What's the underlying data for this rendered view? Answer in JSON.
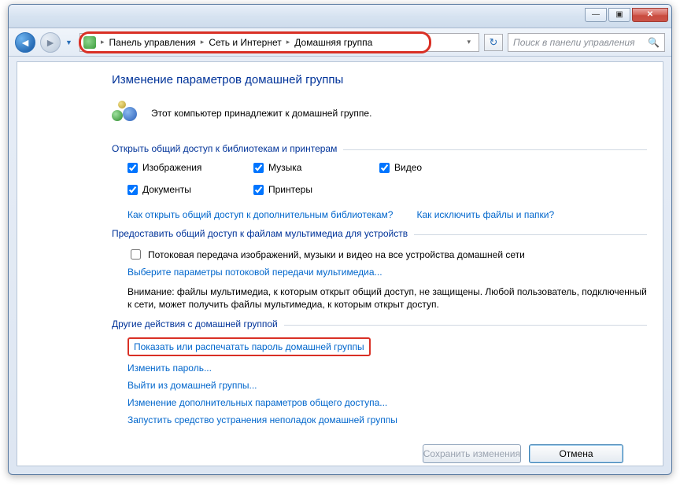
{
  "titlebar": {
    "min": "—",
    "max": "▣",
    "close": "✕"
  },
  "nav": {
    "back_glyph": "◄",
    "fwd_glyph": "►",
    "drop_glyph": "▼",
    "refresh_glyph": "↻",
    "search_glyph": "🔍",
    "search_placeholder": "Поиск в панели управления"
  },
  "breadcrumb": {
    "sep": "▸",
    "items": [
      "Панель управления",
      "Сеть и Интернет",
      "Домашняя группа"
    ],
    "tail": "▾"
  },
  "page": {
    "title": "Изменение параметров домашней группы",
    "belongs": "Этот компьютер принадлежит к домашней группе."
  },
  "share_section": {
    "header": "Открыть общий доступ к библиотекам и принтерам",
    "checks": {
      "images": "Изображения",
      "documents": "Документы",
      "music": "Музыка",
      "printers": "Принтеры",
      "video": "Видео"
    },
    "link_additional": "Как открыть общий доступ к дополнительным библиотекам?",
    "link_exclude": "Как исключить файлы и папки?"
  },
  "media_section": {
    "header": "Предоставить общий доступ к файлам мультимедиа для устройств",
    "stream_check": "Потоковая передача изображений, музыки и видео на все устройства домашней сети",
    "stream_link": "Выберите параметры потоковой передачи мультимедиа...",
    "warning": "Внимание: файлы мультимедиа, к которым открыт общий доступ, не защищены. Любой пользователь, подключенный к сети, может получить файлы мультимедиа, к которым открыт доступ."
  },
  "actions_section": {
    "header": "Другие действия с домашней группой",
    "show_password": "Показать или распечатать пароль домашней группы",
    "change_password": "Изменить пароль...",
    "leave_group": "Выйти из домашней группы...",
    "change_advanced": "Изменение дополнительных параметров общего доступа...",
    "troubleshoot": "Запустить средство устранения неполадок домашней группы"
  },
  "footer": {
    "save": "Сохранить изменения",
    "cancel": "Отмена"
  }
}
